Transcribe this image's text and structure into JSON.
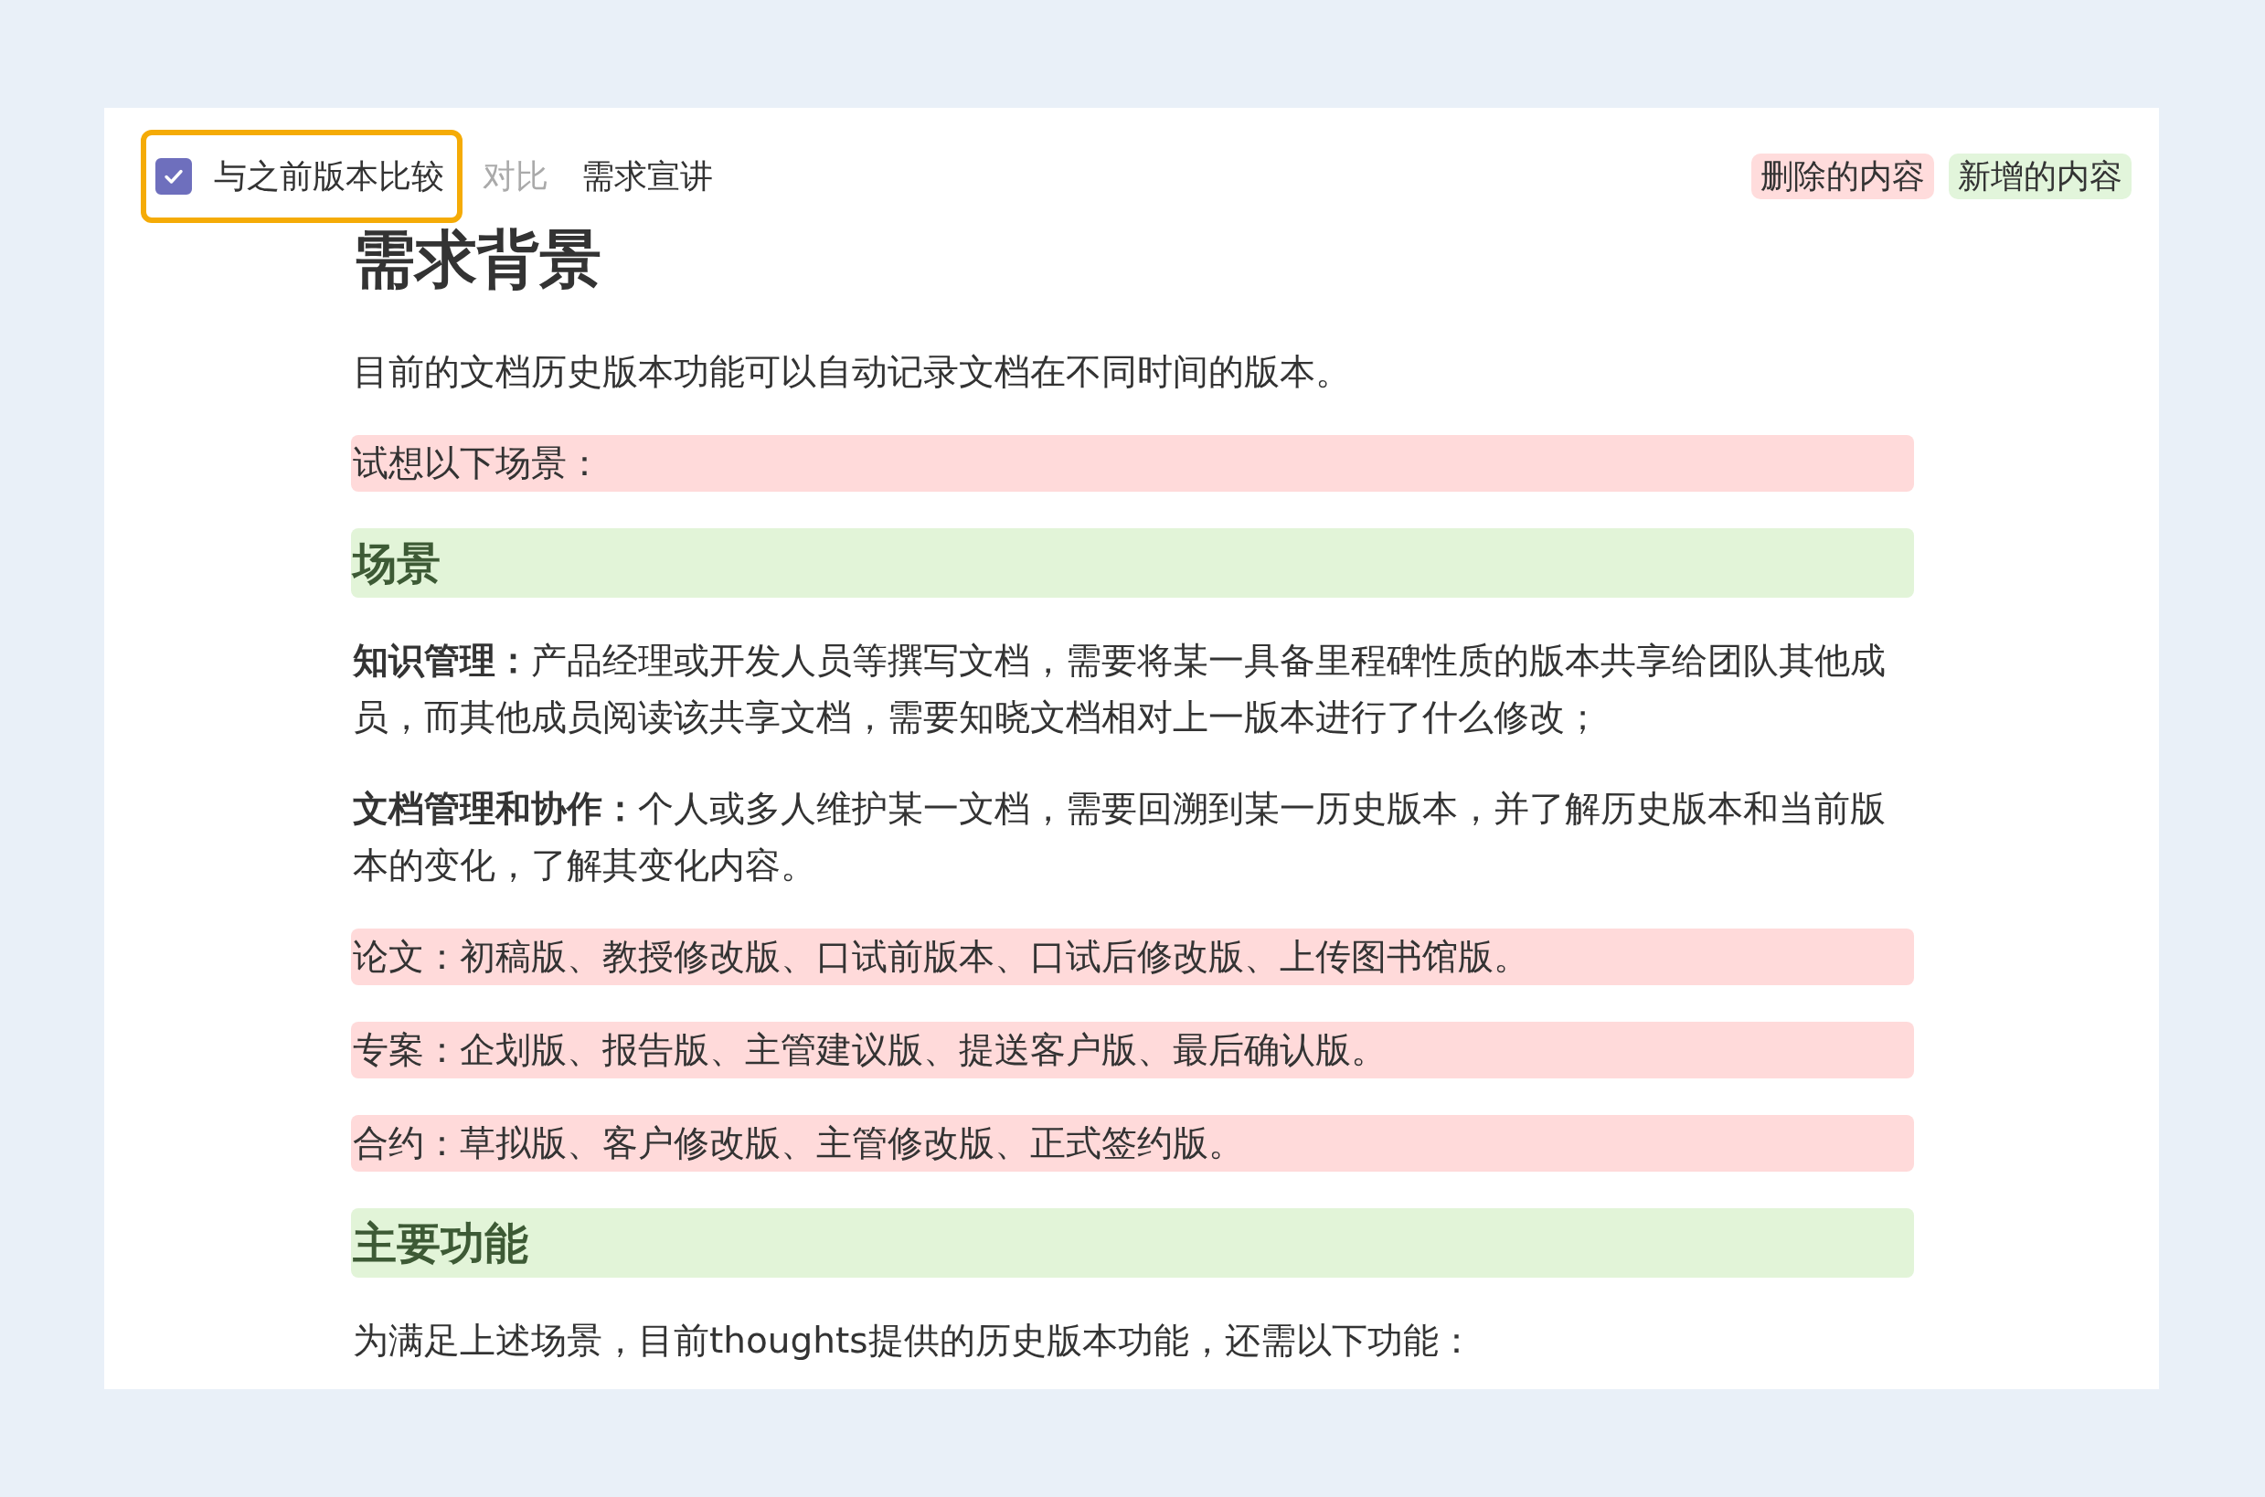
{
  "toolbar": {
    "compare_checkbox": {
      "label": "与之前版本比较",
      "checked": true,
      "focused": true
    },
    "items": [
      {
        "label": "对比",
        "disabled": true
      },
      {
        "label": "需求宣讲",
        "disabled": false
      }
    ],
    "legend": [
      {
        "label": "删除的内容",
        "color": "#ffdcdc"
      },
      {
        "label": "新增的内容",
        "color": "#e2f5db"
      }
    ]
  },
  "document": {
    "blocks": [
      {
        "kind": "title",
        "text": "需求背景",
        "removed": false,
        "added": false
      },
      {
        "kind": "paragraph",
        "text": "目前的文档历史版本功能可以自动记录文档在不同时间的版本。",
        "removed": false,
        "added": false
      },
      {
        "kind": "paragraph",
        "text": "试想以下场景：",
        "removed": true,
        "added": false
      },
      {
        "kind": "heading",
        "text": "场景",
        "removed": false,
        "added": true
      },
      {
        "kind": "paragraph",
        "text": "**知识管理：**产品经理或开发人员等撰写文档，需要将某一具备里程碑性质的版本共享给团队其他成员，而其他成员阅读该共享文档，需要知晓文档相对上一版本进行了什么修改；",
        "removed": false,
        "added": false
      },
      {
        "kind": "paragraph",
        "text": "**文档管理和协作：**个人或多人维护某一文档，需要回溯到某一历史版本，并了解历史版本和当前版本的变化，了解其变化内容。",
        "removed": false,
        "added": false
      },
      {
        "kind": "paragraph",
        "text": "论文：初稿版、教授修改版、口试前版本、口试后修改版、上传图书馆版。",
        "removed": true,
        "added": false
      },
      {
        "kind": "paragraph",
        "text": "专案：企划版、报告版、主管建议版、提送客户版、最后确认版。",
        "removed": true,
        "added": false
      },
      {
        "kind": "paragraph",
        "text": "合约：草拟版、客户修改版、主管修改版、正式签约版。",
        "removed": true,
        "added": false
      },
      {
        "kind": "heading",
        "text": "主要功能",
        "removed": false,
        "added": true
      },
      {
        "kind": "paragraph",
        "text": "为满足上述场景，目前thoughts提供的历史版本功能，还需以下功能：",
        "removed": false,
        "added": false
      }
    ]
  }
}
